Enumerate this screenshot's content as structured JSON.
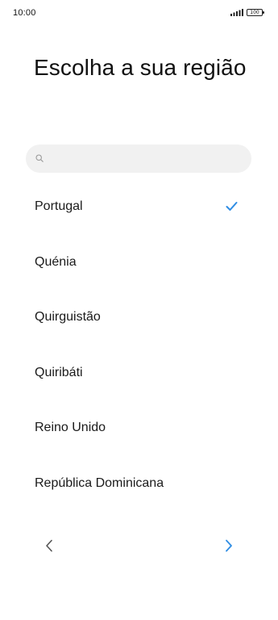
{
  "status_bar": {
    "time": "10:00",
    "battery": "100",
    "icons": [
      "signal-icon",
      "battery-icon"
    ]
  },
  "page": {
    "title": "Escolha a sua região"
  },
  "search": {
    "placeholder": "",
    "value": "",
    "icon": "search-icon"
  },
  "regions": {
    "selected": "Portugal",
    "items": [
      {
        "label": "Portugal"
      },
      {
        "label": "Quénia"
      },
      {
        "label": "Quirguistão"
      },
      {
        "label": "Quiribáti"
      },
      {
        "label": "Reino Unido"
      },
      {
        "label": "República Dominicana"
      }
    ]
  },
  "navigation": {
    "back_icon": "chevron-left-icon",
    "next_icon": "chevron-right-icon"
  },
  "colors": {
    "accent": "#2f8de4",
    "text": "#1a1a1a",
    "search_bg": "#f1f1f1",
    "nav_back": "#555555"
  }
}
